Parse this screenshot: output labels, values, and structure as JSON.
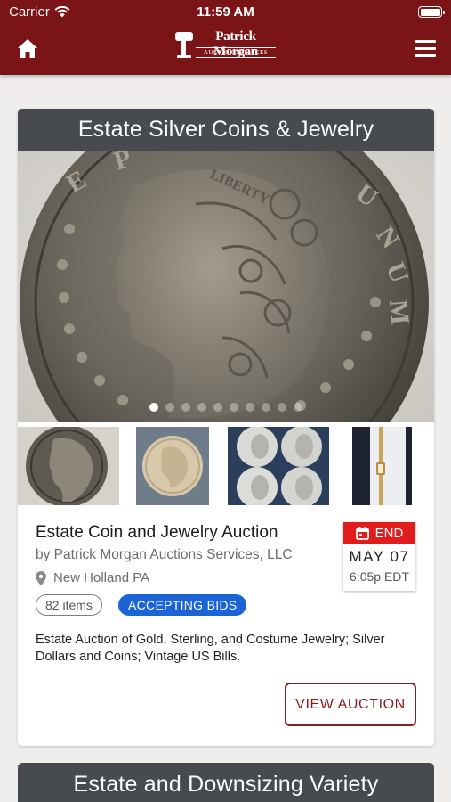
{
  "status_bar": {
    "carrier": "Carrier",
    "time": "11:59 AM"
  },
  "nav": {
    "brand_name": "Patrick Morgan",
    "brand_sub": "AUCTION SERVICES",
    "home_icon": "home-icon",
    "menu_icon": "hamburger-menu-icon"
  },
  "colors": {
    "nav_bg": "#7a1417",
    "card_header_bg": "#474b4f",
    "status_blue": "#1a64d6",
    "end_red": "#e01c1c",
    "button_maroon": "#8a1c1f"
  },
  "auctions": [
    {
      "header": "Estate Silver Coins & Jewelry",
      "carousel": {
        "slide_count": 10,
        "active_index": 0
      },
      "thumbnails": [
        "Morgan silver dollar",
        "Liberty nickel",
        "Four Franklin half dollars",
        "Gold watch"
      ],
      "title": "Estate Coin and Jewelry Auction",
      "by": "by Patrick Morgan Auctions Services, LLC",
      "location": "New Holland PA",
      "items_count": "82 items",
      "status": "ACCEPTING BIDS",
      "end_label": "END",
      "end_date": "MAY 07",
      "end_time": "6:05p EDT",
      "description": "Estate Auction of Gold, Sterling, and Costume Jewelry; Silver Dollars and Coins; Vintage US Bills.",
      "button": "VIEW AUCTION"
    },
    {
      "header": "Estate and Downsizing Variety"
    }
  ]
}
